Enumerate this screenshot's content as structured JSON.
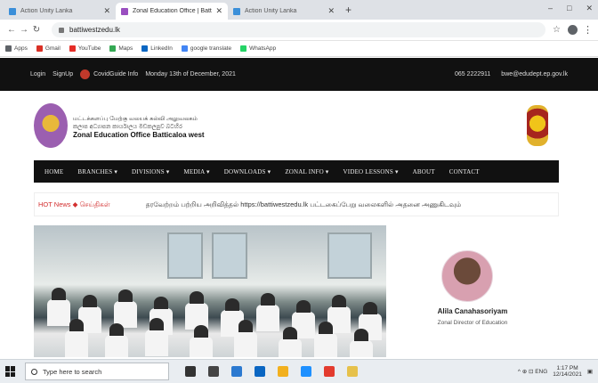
{
  "browser": {
    "tabs": [
      {
        "title": "Action Unity Lanka",
        "favicon_color": "#3b8fd9",
        "active": false
      },
      {
        "title": "Zonal Education Office | Batticaloa",
        "favicon_color": "#9a4fc0",
        "active": true
      },
      {
        "title": "Action Unity Lanka",
        "favicon_color": "#3b8fd9",
        "active": false
      }
    ],
    "new_tab": "+",
    "window_controls": [
      "–",
      "□",
      "✕"
    ],
    "url": "battiwestzedu.lk",
    "bookmarks": [
      {
        "label": "Apps",
        "color": "#5f6368"
      },
      {
        "label": "Gmail",
        "color": "#d93025"
      },
      {
        "label": "YouTube",
        "color": "#e52d27"
      },
      {
        "label": "Maps",
        "color": "#34a853"
      },
      {
        "label": "LinkedIn",
        "color": "#0a66c2"
      },
      {
        "label": "google translate",
        "color": "#4285f4"
      },
      {
        "label": "WhatsApp",
        "color": "#25d366"
      }
    ]
  },
  "site": {
    "top_links": [
      "Login",
      "SignUp"
    ],
    "covid_info": "CovidGuide Info",
    "date": "Monday 13th of December, 2021",
    "phone": "065 2222911",
    "email": "bwe@edudept.ep.gov.lk",
    "title_line1": "மட்டக்களப்பு மேற்கு வலயக் கல்வி அலுவலகம்",
    "title_line2": "කලාප අධ්‍යාපන කාර්යාලය මඩකලපුව බටහිර",
    "title_line3": "Zonal Education Office Batticaloa west",
    "nav": [
      "HOME",
      "BRANCHES ▾",
      "DIVISIONS ▾",
      "MEDIA ▾",
      "DOWNLOADS ▾",
      "ZONAL INFO ▾",
      "VIDEO LESSONS ▾",
      "ABOUT",
      "CONTACT"
    ],
    "news_label": "HOT News ◆ செய்திகள்",
    "news_text": "தரவேற்றம் பற்றிய அறிவித்தல் https://battiwestzedu.lk பட்டகைப்பேறு வலைகளில் அதனை அணுகிடவும்",
    "profile_name": "Alila Canahasoriyam",
    "profile_role": "Zonal Director of Education"
  },
  "taskbar": {
    "search_placeholder": "Type here to search",
    "icons": [
      {
        "name": "cortana-icon",
        "color": "#333333"
      },
      {
        "name": "task-view-icon",
        "color": "#444444"
      },
      {
        "name": "store-icon",
        "color": "#2b79d0"
      },
      {
        "name": "outlook-icon",
        "color": "#0a66c2"
      },
      {
        "name": "file-explorer-icon",
        "color": "#f2b01e"
      },
      {
        "name": "edge-icon",
        "color": "#1e90ff"
      },
      {
        "name": "chrome-icon",
        "color": "#e33b2e"
      },
      {
        "name": "paint-icon",
        "color": "#e6c14b"
      }
    ],
    "tray": "^ ⊕ ⊡ ENG",
    "time": "1:17 PM",
    "date": "12/14/2021"
  }
}
